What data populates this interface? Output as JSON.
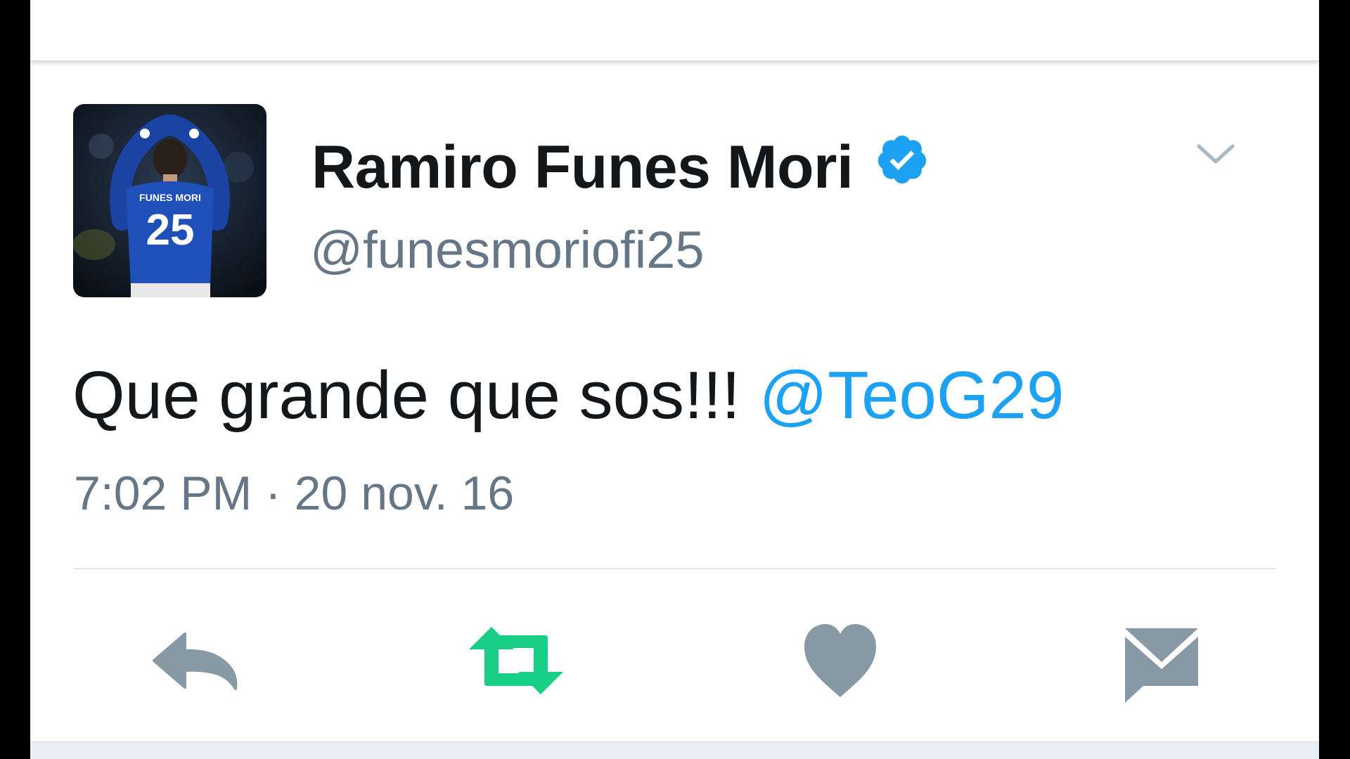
{
  "tweet": {
    "author": {
      "display_name": "Ramiro Funes Mori",
      "handle": "@funesmoriofi25",
      "verified": true,
      "avatar_jersey": {
        "name": "FUNES MORI",
        "number": "25"
      }
    },
    "text": "Que grande que sos!!! ",
    "mention": "@TeoG29",
    "timestamp": "7:02 PM · 20 nov. 16"
  },
  "actions": [
    {
      "name": "reply",
      "icon": "reply-icon"
    },
    {
      "name": "retweet",
      "icon": "retweet-icon",
      "active": true
    },
    {
      "name": "like",
      "icon": "heart-icon"
    },
    {
      "name": "direct-message",
      "icon": "envelope-icon"
    }
  ],
  "colors": {
    "text": "#14171a",
    "secondary": "#657786",
    "link": "#1da1f2",
    "verified": "#1da1f2",
    "retweet_active": "#19cf86",
    "action_inactive": "#8899a6"
  }
}
